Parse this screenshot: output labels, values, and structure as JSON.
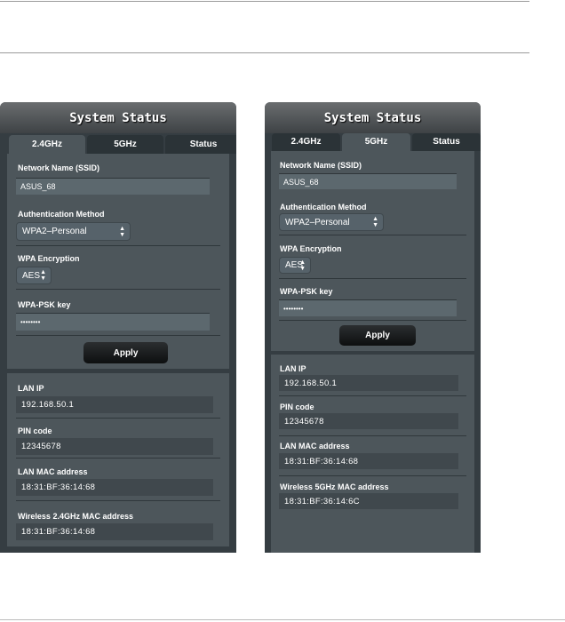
{
  "panels": [
    {
      "title": "System Status",
      "tabs": [
        "2.4GHz",
        "5GHz",
        "Status"
      ],
      "active_tab": "2.4GHz",
      "ssid_label": "Network Name (SSID)",
      "ssid_value": "ASUS_68",
      "auth_label": "Authentication Method",
      "auth_value": "WPA2–Personal",
      "enc_label": "WPA Encryption",
      "enc_value": "AES",
      "psk_label": "WPA-PSK key",
      "psk_value": "••••••••",
      "apply_label": "Apply",
      "lan_ip_label": "LAN IP",
      "lan_ip_value": "192.168.50.1",
      "pin_label": "PIN code",
      "pin_value": "12345678",
      "lan_mac_label": "LAN MAC address",
      "lan_mac_value": "18:31:BF:36:14:68",
      "wl_mac_label": "Wireless 2.4GHz MAC address",
      "wl_mac_value": "18:31:BF:36:14:68"
    },
    {
      "title": "System Status",
      "tabs": [
        "2.4GHz",
        "5GHz",
        "Status"
      ],
      "active_tab": "5GHz",
      "ssid_label": "Network Name (SSID)",
      "ssid_value": "ASUS_68",
      "auth_label": "Authentication Method",
      "auth_value": "WPA2–Personal",
      "enc_label": "WPA Encryption",
      "enc_value": "AES",
      "psk_label": "WPA-PSK key",
      "psk_value": "••••••••",
      "apply_label": "Apply",
      "lan_ip_label": "LAN IP",
      "lan_ip_value": "192.168.50.1",
      "pin_label": "PIN code",
      "pin_value": "12345678",
      "lan_mac_label": "LAN MAC address",
      "lan_mac_value": "18:31:BF:36:14:68",
      "wl_mac_label": "Wireless 5GHz MAC address",
      "wl_mac_value": "18:31:BF:36:14:6C"
    }
  ]
}
